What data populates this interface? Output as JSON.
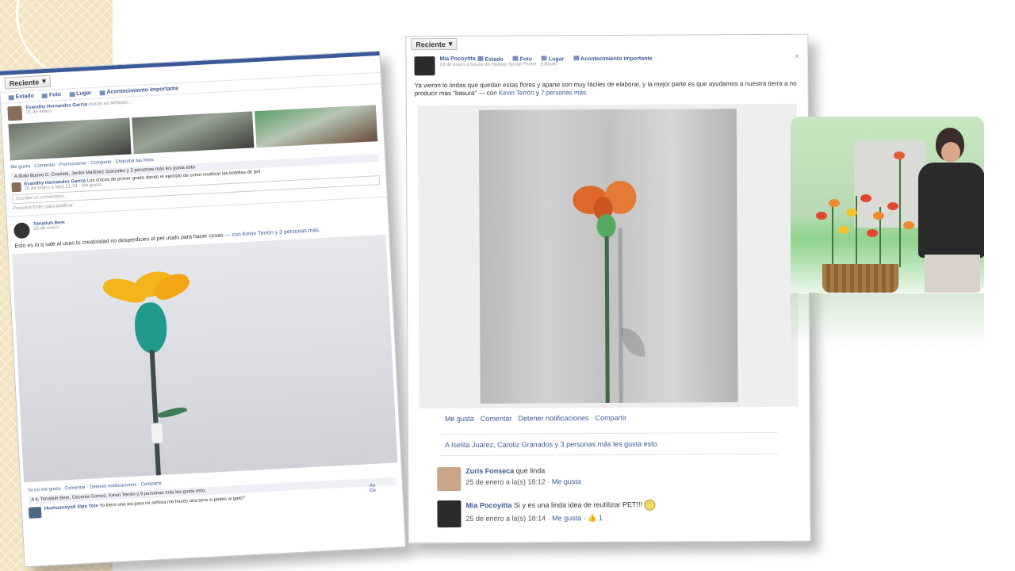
{
  "left_card": {
    "feed_filter": "Reciente",
    "composer": [
      "Estado",
      "Foto",
      "Lugar",
      "Acontecimiento importante"
    ],
    "post1": {
      "author": "Evandhy Hernandez Garcia",
      "action": "estuvo en Metepec...",
      "time": "25 de enero",
      "actions": "Me gusta · Comentar · Promocionar · Compartir · Etiquetar las fotos",
      "likes": "A Ibalo Bueno C. Cravista, Jonfer Martinez Gonzalez y 2 personas más les gusta esto.",
      "comment": {
        "author": "Evandhy Hernandez Garcia",
        "text": "Los chicos de primer grado dando el ejemplo de como reutilizar las botellas de pet",
        "time": "25 de enero a la(s) 21:34 · Me gusta"
      },
      "comment_placeholder": "Escribe un comentario...",
      "enter_hint": "Presiona Enter para publicar."
    },
    "post2": {
      "author": "Tonatiuh Bem",
      "time": "25 de enero",
      "text": "Esto es lo q sale al usas tu creatividad no desperdicies el pet usalo para hacer cosas",
      "with": "— con Kevin Terrón y 3 personas más.",
      "actions": "Ya no me gusta · Comentar · Detener notificaciones · Compartir",
      "likes": "A ti, Tonatiuh Bem, Cecenia Gomez, Kevin Terrón y 9 personas más les gusta esto.",
      "comment_author": "Huehuecoyotl Xipe Tote",
      "comment_text": "Yo kiero una asi para mi señora me haces una tana si podes ai gato?"
    },
    "sidebar_fragment": [
      "An",
      "Ge"
    ]
  },
  "right_card": {
    "feed_filter": "Reciente",
    "composer": [
      "Estado",
      "Foto",
      "Lugar",
      "Acontecimiento importante"
    ],
    "author": "Mia Pocoyitta",
    "time": "24 de enero a través de Huawei Social Phone · Editado",
    "text": "Ya vieron lo lindas que quedan estas flores y aparte son muy fáciles de elaborar, y la mejor parte es que ayudamos a nuestra tierra a no producir mas \"basura\"",
    "with_prefix": "— con",
    "with_names": "Kevin Terrón",
    "with_suffix_y": "y",
    "with_others": "7 personas más.",
    "actions": [
      "Me gusta",
      "Comentar",
      "Detener notificaciones",
      "Compartir"
    ],
    "likes": "A Iselita Juarez, Caroliz Granados y 3 personas más les gusta esto.",
    "comments": [
      {
        "author": "Zuris Fonseca",
        "text": "que linda",
        "time": "25 de enero a la(s) 18:12",
        "like": "Me gusta"
      },
      {
        "author": "Mia Pocoyitta",
        "text": "Si y es una linda idea de reutilizar PET!!!",
        "time": "25 de enero a la(s) 18:14",
        "like": "Me gusta",
        "count": "1"
      }
    ]
  },
  "colors": {
    "facebook_blue": "#3b5998",
    "deco_strip": "#f3e4c0"
  }
}
